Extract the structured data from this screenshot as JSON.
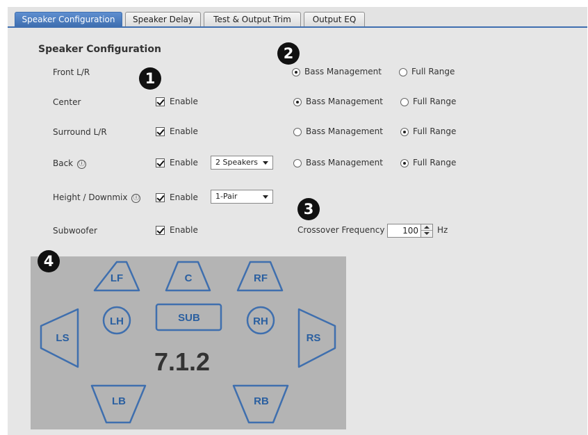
{
  "tabs": [
    {
      "label": "Speaker Configuration",
      "active": true
    },
    {
      "label": "Speaker Delay",
      "active": false
    },
    {
      "label": "Test & Output Trim",
      "active": false
    },
    {
      "label": "Output EQ",
      "active": false
    }
  ],
  "section_title": "Speaker Configuration",
  "rows": {
    "front": {
      "label": "Front L/R",
      "mode": "Bass Management"
    },
    "center": {
      "label": "Center",
      "enabled": true,
      "enable_label": "Enable",
      "mode": "Bass Management"
    },
    "surround": {
      "label": "Surround L/R",
      "enabled": true,
      "enable_label": "Enable",
      "mode": "Full Range"
    },
    "back": {
      "label": "Back",
      "enabled": true,
      "enable_label": "Enable",
      "select_value": "2 Speakers",
      "mode": "Full Range"
    },
    "height": {
      "label": "Height / Downmix",
      "enabled": true,
      "enable_label": "Enable",
      "select_value": "1-Pair"
    },
    "subwoofer": {
      "label": "Subwoofer",
      "enabled": true,
      "enable_label": "Enable"
    }
  },
  "mode_options": {
    "bass": "Bass Management",
    "full": "Full Range"
  },
  "info_glyph": "ⓘ",
  "crossover": {
    "label": "Crossover Frequency",
    "value": "100",
    "unit": "Hz"
  },
  "badges": [
    "1",
    "2",
    "3",
    "4"
  ],
  "diagram": {
    "speakers": [
      "LF",
      "C",
      "RF",
      "LH",
      "SUB",
      "RH",
      "LS",
      "RS",
      "LB",
      "RB"
    ],
    "layout_label": "7.1.2",
    "outline_color": "#3f6fae",
    "text_color": "#2a5fa0",
    "background": "#b4b4b4"
  },
  "colors": {
    "tab_active": "#3f6fb0",
    "panel_bg": "#e6e6e6"
  }
}
